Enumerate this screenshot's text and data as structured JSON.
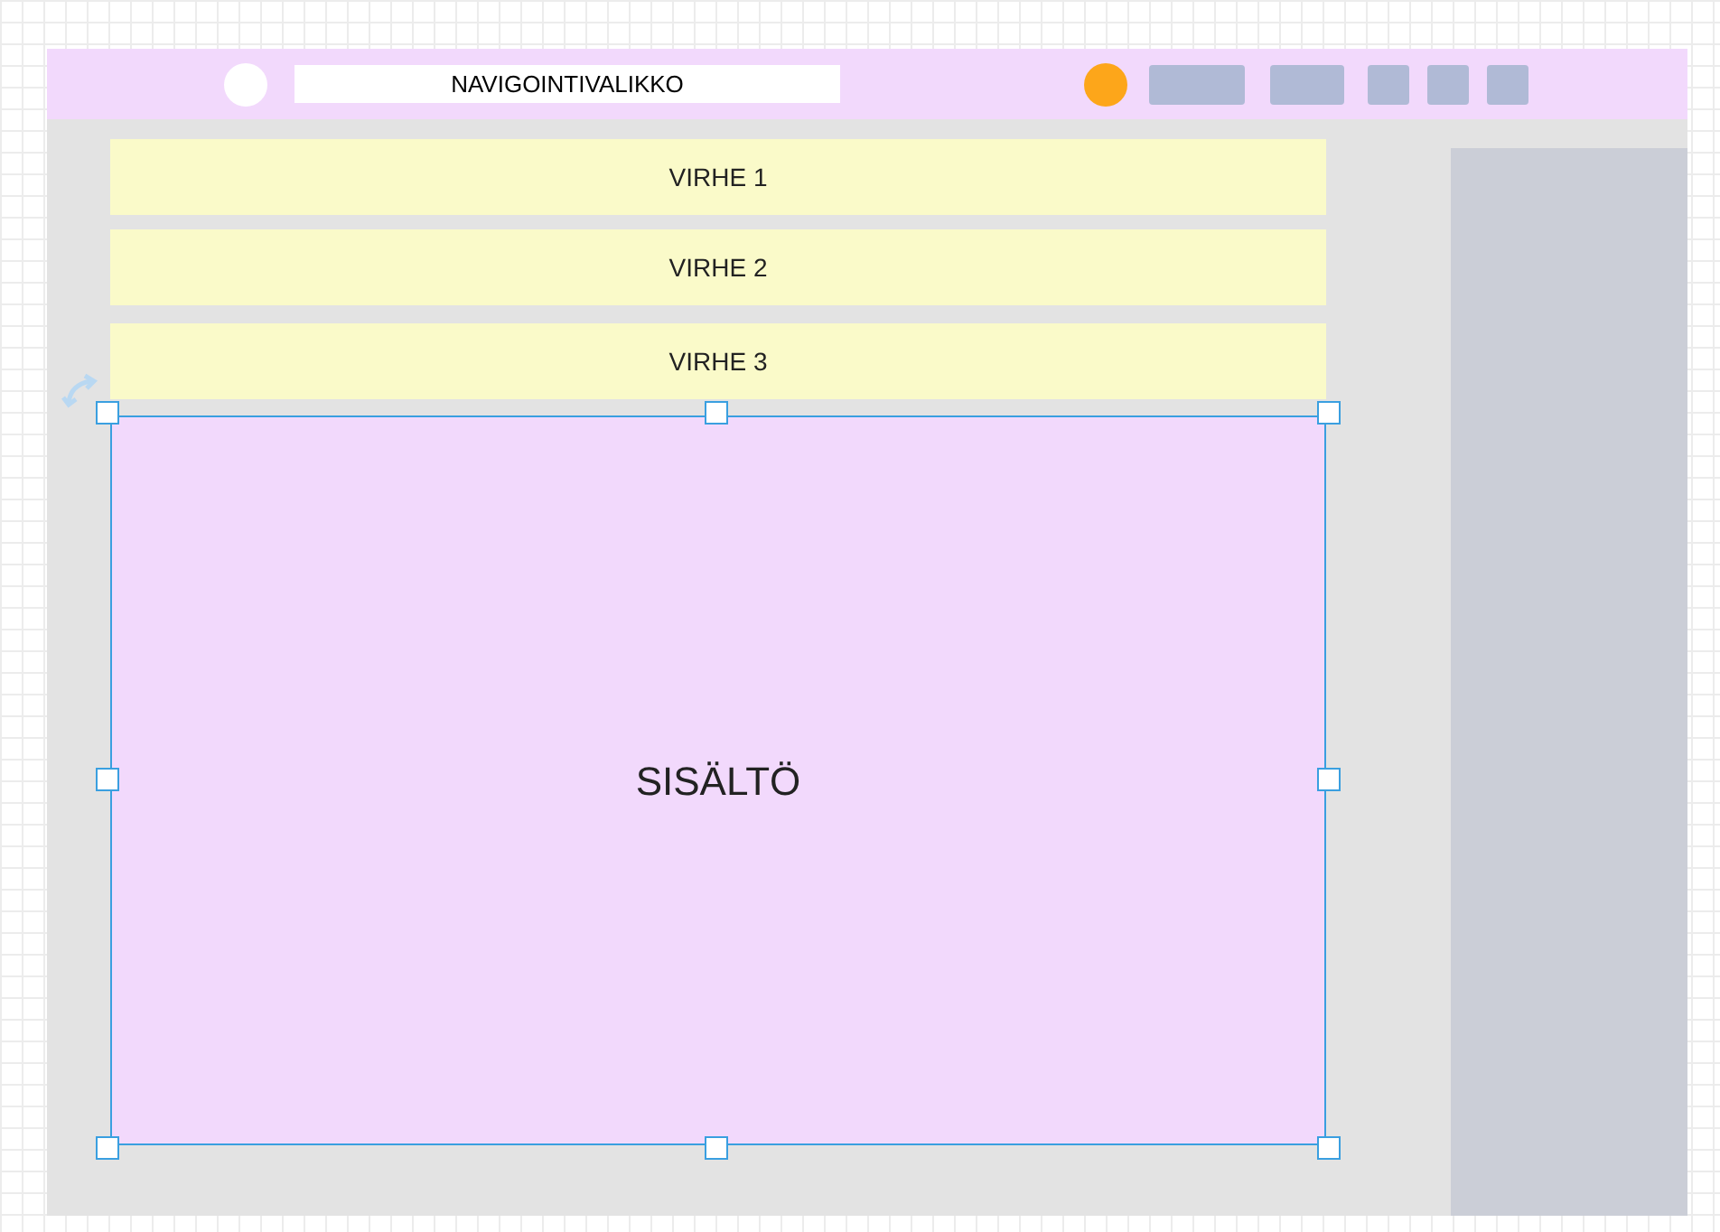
{
  "header": {
    "title": "NAVIGOINTIVALIKKO"
  },
  "errors": [
    {
      "label": "VIRHE 1"
    },
    {
      "label": "VIRHE 2"
    },
    {
      "label": "VIRHE 3"
    }
  ],
  "content": {
    "label": "SISÄLTÖ",
    "selected": true
  }
}
